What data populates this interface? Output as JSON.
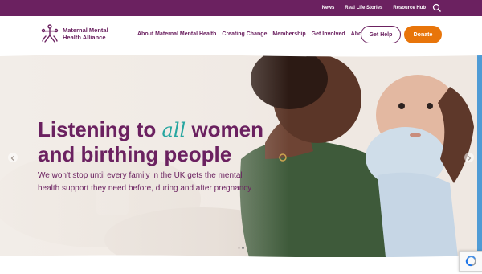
{
  "topbar": {
    "links": [
      "News",
      "Real Life Stories",
      "Resource Hub"
    ],
    "search_icon": "search-icon"
  },
  "logo": {
    "line1": "Maternal Mental",
    "line2": "Health Alliance"
  },
  "nav": [
    "About Maternal Mental Health",
    "Creating Change",
    "Membership",
    "Get Involved",
    "About Us"
  ],
  "buttons": {
    "help": "Get Help",
    "donate": "Donate"
  },
  "hero": {
    "headline_before": "Listening to ",
    "headline_emph": "all",
    "headline_after": " women",
    "headline_line2": "and birthing people",
    "subtext": "We won't stop until every family in the UK gets the mental health support they need before, during and after pregnancy"
  },
  "colors": {
    "brand_purple": "#6b2160",
    "donate_orange": "#e8750a",
    "accent_teal": "#27a6a0"
  }
}
